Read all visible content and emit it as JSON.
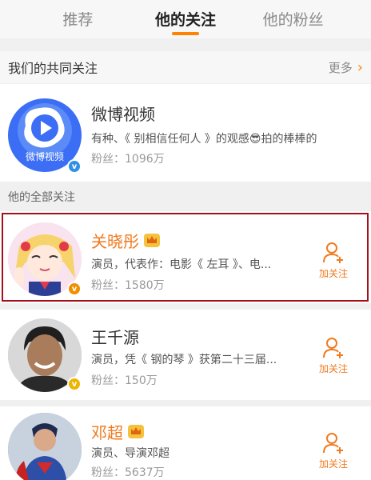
{
  "tabs": [
    {
      "label": "推荐",
      "active": false
    },
    {
      "label": "他的关注",
      "active": true
    },
    {
      "label": "他的粉丝",
      "active": false
    }
  ],
  "common_section": {
    "title": "我们的共同关注",
    "more_label": "更多"
  },
  "all_section": {
    "title": "他的全部关注"
  },
  "colors": {
    "accent": "#ff8200",
    "highlight_border": "#a5101b",
    "verified_blue": "#2e91e6",
    "verified_orange": "#f08f00"
  },
  "users": [
    {
      "name": "微博视频",
      "avatar_text": "微博视频",
      "desc": "有种、《 别相信任何人 》的观感😎拍的棒棒的",
      "fans": "粉丝：1096万",
      "follow_label": ""
    },
    {
      "name": "关晓彤",
      "desc": "演员，代表作：电影《 左耳 》、电...",
      "fans": "粉丝：1580万",
      "follow_label": "加关注"
    },
    {
      "name": "王千源",
      "desc": "演员，凭《 钢的琴 》获第二十三届...",
      "fans": "粉丝：150万",
      "follow_label": "加关注"
    },
    {
      "name": "邓超",
      "desc": "演员、导演邓超",
      "fans": "粉丝：5637万",
      "follow_label": "加关注"
    }
  ]
}
